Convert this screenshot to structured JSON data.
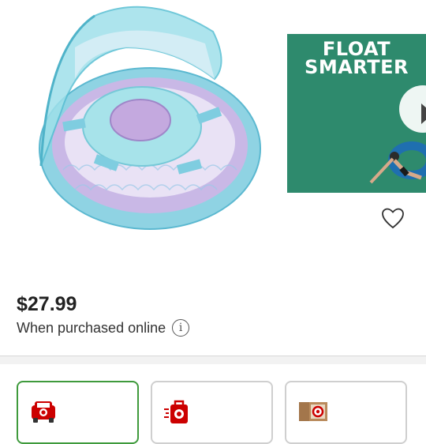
{
  "product": {
    "image_alt": "Mermaid baby float with canopy"
  },
  "promo": {
    "headline_line1": "FLOAT",
    "headline_line2": "SMARTER"
  },
  "pricing": {
    "price": "$27.99",
    "note": "When purchased online",
    "info_glyph": "i"
  },
  "fulfillment_options": [
    {
      "icon": "drive-up-car-icon",
      "selected": true
    },
    {
      "icon": "order-pickup-bag-icon",
      "selected": false
    },
    {
      "icon": "shipping-box-icon",
      "selected": false
    }
  ],
  "colors": {
    "accent_red": "#cc0000",
    "selected_green": "#3f9a3c",
    "promo_green": "#2e8a6d"
  }
}
